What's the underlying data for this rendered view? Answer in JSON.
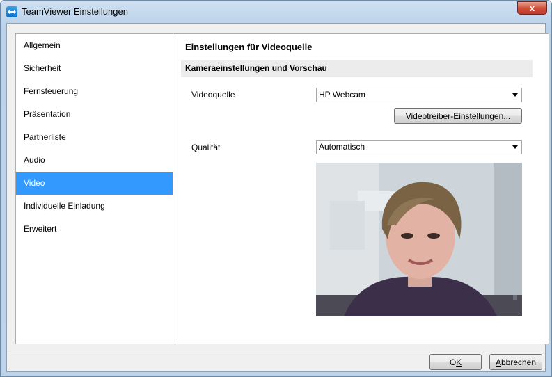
{
  "window": {
    "title": "TeamViewer Einstellungen",
    "close_glyph": "x"
  },
  "sidebar": {
    "items": [
      {
        "label": "Allgemein",
        "selected": false
      },
      {
        "label": "Sicherheit",
        "selected": false
      },
      {
        "label": "Fernsteuerung",
        "selected": false
      },
      {
        "label": "Präsentation",
        "selected": false
      },
      {
        "label": "Partnerliste",
        "selected": false
      },
      {
        "label": "Audio",
        "selected": false
      },
      {
        "label": "Video",
        "selected": true
      },
      {
        "label": "Individuelle Einladung",
        "selected": false
      },
      {
        "label": "Erweitert",
        "selected": false
      }
    ]
  },
  "panel": {
    "title": "Einstellungen für Videoquelle",
    "section_header": "Kameraeinstellungen und Vorschau",
    "video_source": {
      "label": "Videoquelle",
      "value": "HP Webcam"
    },
    "driver_button": "Videotreiber-Einstellungen...",
    "quality": {
      "label": "Qualität",
      "value": "Automatisch"
    }
  },
  "footer": {
    "ok": "OK",
    "ok_mnemonic": "K",
    "cancel": "Abbrechen",
    "cancel_mnemonic": "A"
  },
  "colors": {
    "selection": "#3399ff",
    "titlebar": "#b9d1ea",
    "close": "#c0392b"
  }
}
